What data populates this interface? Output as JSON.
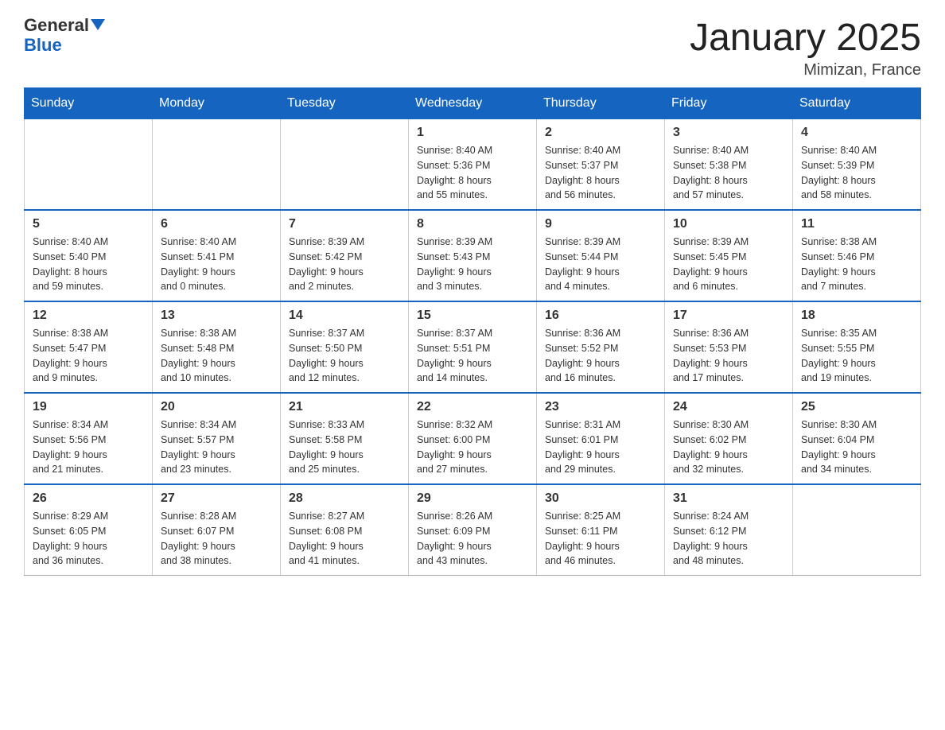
{
  "header": {
    "logo_line1": "General",
    "logo_line2": "Blue",
    "main_title": "January 2025",
    "subtitle": "Mimizan, France"
  },
  "calendar": {
    "days_of_week": [
      "Sunday",
      "Monday",
      "Tuesday",
      "Wednesday",
      "Thursday",
      "Friday",
      "Saturday"
    ],
    "weeks": [
      [
        {
          "day": "",
          "info": ""
        },
        {
          "day": "",
          "info": ""
        },
        {
          "day": "",
          "info": ""
        },
        {
          "day": "1",
          "info": "Sunrise: 8:40 AM\nSunset: 5:36 PM\nDaylight: 8 hours\nand 55 minutes."
        },
        {
          "day": "2",
          "info": "Sunrise: 8:40 AM\nSunset: 5:37 PM\nDaylight: 8 hours\nand 56 minutes."
        },
        {
          "day": "3",
          "info": "Sunrise: 8:40 AM\nSunset: 5:38 PM\nDaylight: 8 hours\nand 57 minutes."
        },
        {
          "day": "4",
          "info": "Sunrise: 8:40 AM\nSunset: 5:39 PM\nDaylight: 8 hours\nand 58 minutes."
        }
      ],
      [
        {
          "day": "5",
          "info": "Sunrise: 8:40 AM\nSunset: 5:40 PM\nDaylight: 8 hours\nand 59 minutes."
        },
        {
          "day": "6",
          "info": "Sunrise: 8:40 AM\nSunset: 5:41 PM\nDaylight: 9 hours\nand 0 minutes."
        },
        {
          "day": "7",
          "info": "Sunrise: 8:39 AM\nSunset: 5:42 PM\nDaylight: 9 hours\nand 2 minutes."
        },
        {
          "day": "8",
          "info": "Sunrise: 8:39 AM\nSunset: 5:43 PM\nDaylight: 9 hours\nand 3 minutes."
        },
        {
          "day": "9",
          "info": "Sunrise: 8:39 AM\nSunset: 5:44 PM\nDaylight: 9 hours\nand 4 minutes."
        },
        {
          "day": "10",
          "info": "Sunrise: 8:39 AM\nSunset: 5:45 PM\nDaylight: 9 hours\nand 6 minutes."
        },
        {
          "day": "11",
          "info": "Sunrise: 8:38 AM\nSunset: 5:46 PM\nDaylight: 9 hours\nand 7 minutes."
        }
      ],
      [
        {
          "day": "12",
          "info": "Sunrise: 8:38 AM\nSunset: 5:47 PM\nDaylight: 9 hours\nand 9 minutes."
        },
        {
          "day": "13",
          "info": "Sunrise: 8:38 AM\nSunset: 5:48 PM\nDaylight: 9 hours\nand 10 minutes."
        },
        {
          "day": "14",
          "info": "Sunrise: 8:37 AM\nSunset: 5:50 PM\nDaylight: 9 hours\nand 12 minutes."
        },
        {
          "day": "15",
          "info": "Sunrise: 8:37 AM\nSunset: 5:51 PM\nDaylight: 9 hours\nand 14 minutes."
        },
        {
          "day": "16",
          "info": "Sunrise: 8:36 AM\nSunset: 5:52 PM\nDaylight: 9 hours\nand 16 minutes."
        },
        {
          "day": "17",
          "info": "Sunrise: 8:36 AM\nSunset: 5:53 PM\nDaylight: 9 hours\nand 17 minutes."
        },
        {
          "day": "18",
          "info": "Sunrise: 8:35 AM\nSunset: 5:55 PM\nDaylight: 9 hours\nand 19 minutes."
        }
      ],
      [
        {
          "day": "19",
          "info": "Sunrise: 8:34 AM\nSunset: 5:56 PM\nDaylight: 9 hours\nand 21 minutes."
        },
        {
          "day": "20",
          "info": "Sunrise: 8:34 AM\nSunset: 5:57 PM\nDaylight: 9 hours\nand 23 minutes."
        },
        {
          "day": "21",
          "info": "Sunrise: 8:33 AM\nSunset: 5:58 PM\nDaylight: 9 hours\nand 25 minutes."
        },
        {
          "day": "22",
          "info": "Sunrise: 8:32 AM\nSunset: 6:00 PM\nDaylight: 9 hours\nand 27 minutes."
        },
        {
          "day": "23",
          "info": "Sunrise: 8:31 AM\nSunset: 6:01 PM\nDaylight: 9 hours\nand 29 minutes."
        },
        {
          "day": "24",
          "info": "Sunrise: 8:30 AM\nSunset: 6:02 PM\nDaylight: 9 hours\nand 32 minutes."
        },
        {
          "day": "25",
          "info": "Sunrise: 8:30 AM\nSunset: 6:04 PM\nDaylight: 9 hours\nand 34 minutes."
        }
      ],
      [
        {
          "day": "26",
          "info": "Sunrise: 8:29 AM\nSunset: 6:05 PM\nDaylight: 9 hours\nand 36 minutes."
        },
        {
          "day": "27",
          "info": "Sunrise: 8:28 AM\nSunset: 6:07 PM\nDaylight: 9 hours\nand 38 minutes."
        },
        {
          "day": "28",
          "info": "Sunrise: 8:27 AM\nSunset: 6:08 PM\nDaylight: 9 hours\nand 41 minutes."
        },
        {
          "day": "29",
          "info": "Sunrise: 8:26 AM\nSunset: 6:09 PM\nDaylight: 9 hours\nand 43 minutes."
        },
        {
          "day": "30",
          "info": "Sunrise: 8:25 AM\nSunset: 6:11 PM\nDaylight: 9 hours\nand 46 minutes."
        },
        {
          "day": "31",
          "info": "Sunrise: 8:24 AM\nSunset: 6:12 PM\nDaylight: 9 hours\nand 48 minutes."
        },
        {
          "day": "",
          "info": ""
        }
      ]
    ]
  }
}
